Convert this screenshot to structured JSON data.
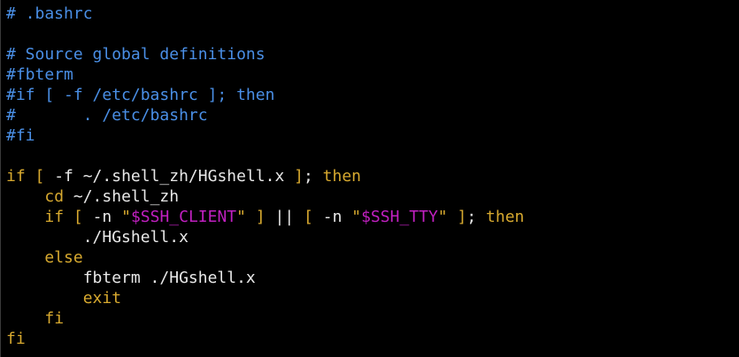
{
  "colors": {
    "background": "#000000",
    "comment": "#4a8fe6",
    "default": "#e8e8e8",
    "keyword": "#d7a92f",
    "bracket": "#d7a92f",
    "string": "#c020c0"
  },
  "lines": [
    [
      {
        "t": "# .bashrc",
        "k": "comment"
      }
    ],
    [],
    [
      {
        "t": "# Source global definitions",
        "k": "comment"
      }
    ],
    [
      {
        "t": "#fbterm",
        "k": "comment"
      }
    ],
    [
      {
        "t": "#if [ -f /etc/bashrc ]; then",
        "k": "comment"
      }
    ],
    [
      {
        "t": "#       . /etc/bashrc",
        "k": "comment"
      }
    ],
    [
      {
        "t": "#fi",
        "k": "comment"
      }
    ],
    [],
    [
      {
        "t": "if",
        "k": "keyword"
      },
      {
        "t": " ",
        "k": "default"
      },
      {
        "t": "[",
        "k": "bracket"
      },
      {
        "t": " -f ~/.shell_zh/HGshell.x ",
        "k": "default"
      },
      {
        "t": "]",
        "k": "bracket"
      },
      {
        "t": "; ",
        "k": "default"
      },
      {
        "t": "then",
        "k": "keyword"
      }
    ],
    [
      {
        "t": "    ",
        "k": "default"
      },
      {
        "t": "cd",
        "k": "keyword"
      },
      {
        "t": " ~/.shell_zh",
        "k": "default"
      }
    ],
    [
      {
        "t": "    ",
        "k": "default"
      },
      {
        "t": "if",
        "k": "keyword"
      },
      {
        "t": " ",
        "k": "default"
      },
      {
        "t": "[",
        "k": "bracket"
      },
      {
        "t": " -n ",
        "k": "default"
      },
      {
        "t": "\"",
        "k": "keyword"
      },
      {
        "t": "$SSH_CLIENT",
        "k": "string"
      },
      {
        "t": "\"",
        "k": "keyword"
      },
      {
        "t": " ",
        "k": "default"
      },
      {
        "t": "]",
        "k": "bracket"
      },
      {
        "t": " || ",
        "k": "default"
      },
      {
        "t": "[",
        "k": "bracket"
      },
      {
        "t": " -n ",
        "k": "default"
      },
      {
        "t": "\"",
        "k": "keyword"
      },
      {
        "t": "$SSH_TTY",
        "k": "string"
      },
      {
        "t": "\"",
        "k": "keyword"
      },
      {
        "t": " ",
        "k": "default"
      },
      {
        "t": "]",
        "k": "bracket"
      },
      {
        "t": "; ",
        "k": "default"
      },
      {
        "t": "then",
        "k": "keyword"
      }
    ],
    [
      {
        "t": "        ./HGshell.x",
        "k": "default"
      }
    ],
    [
      {
        "t": "    ",
        "k": "default"
      },
      {
        "t": "else",
        "k": "keyword"
      }
    ],
    [
      {
        "t": "        fbterm ./HGshell.x",
        "k": "default"
      }
    ],
    [
      {
        "t": "        ",
        "k": "default"
      },
      {
        "t": "exit",
        "k": "keyword"
      }
    ],
    [
      {
        "t": "    ",
        "k": "default"
      },
      {
        "t": "fi",
        "k": "keyword"
      }
    ],
    [
      {
        "t": "fi",
        "k": "keyword"
      }
    ]
  ]
}
